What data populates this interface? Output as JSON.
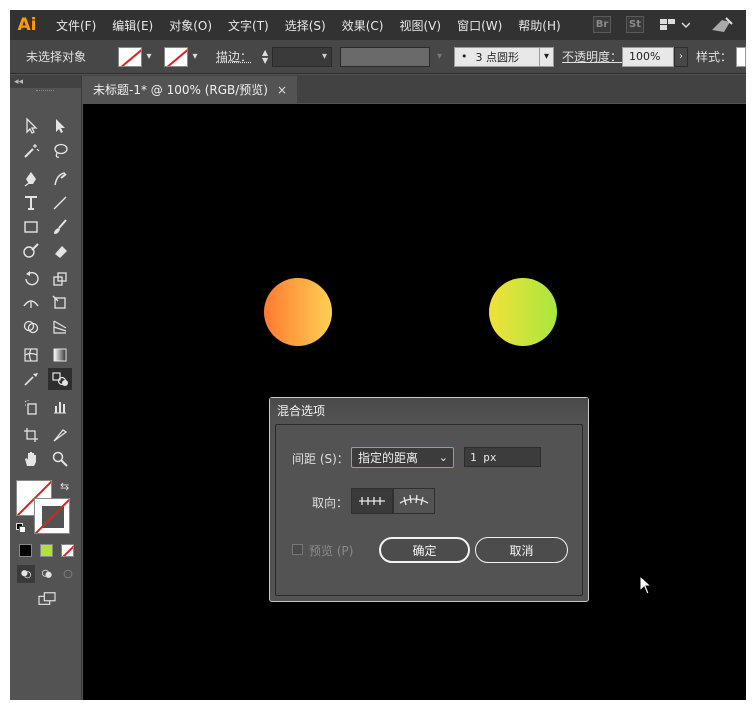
{
  "app": {
    "logo": "Ai"
  },
  "menubar": {
    "items": [
      "文件(F)",
      "编辑(E)",
      "对象(O)",
      "文字(T)",
      "选择(S)",
      "效果(C)",
      "视图(V)",
      "窗口(W)",
      "帮助(H)"
    ],
    "bridge_badge": "Br",
    "stock_badge": "St"
  },
  "controlbar": {
    "selection_status": "未选择对象",
    "stroke_label": "描边：",
    "brush_value": "3 点圆形",
    "brush_dot": "•",
    "opacity_label": "不透明度：",
    "opacity_value": "100%",
    "style_label": "样式："
  },
  "document": {
    "tab_title": "未标题-1* @ 100% (RGB/预览)",
    "close_glyph": "×"
  },
  "canvas": {
    "circle_left_gradient": [
      "#ff7a30",
      "#ffd055"
    ],
    "circle_right_gradient": [
      "#f2e03a",
      "#a8e83c"
    ],
    "background": "#000000"
  },
  "swatches": {
    "fill_colors": [
      "#000000",
      "#b4e03c",
      "#ffffff"
    ]
  },
  "dialog": {
    "title": "混合选项",
    "spacing_label": "间距 (S)：",
    "spacing_mode": "指定的距离",
    "spacing_value": "1 px",
    "orientation_label": "取向：",
    "preview_label": "预览 (P)",
    "ok_label": "确定",
    "cancel_label": "取消"
  }
}
